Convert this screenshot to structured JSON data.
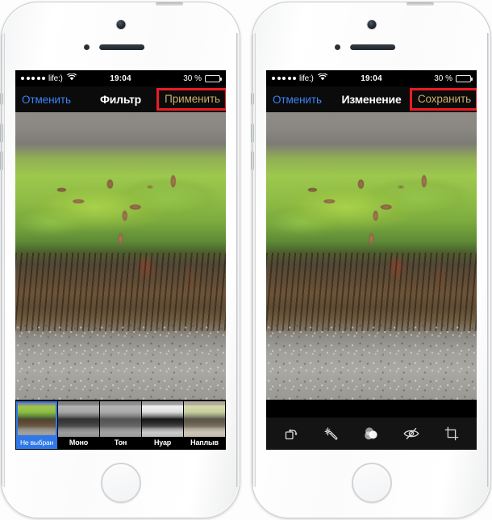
{
  "meta": {
    "description": "Two iPhone screenshots side by side showing the iOS Photos app filter screen and edit screen in Russian"
  },
  "colors": {
    "nav_action": "#c9ae6c",
    "nav_cancel": "#3b83f7",
    "highlight_box": "#ec1c24",
    "selected_blue": "#2f78e8",
    "screen_bg": "#000000"
  },
  "status_bar": {
    "signal_dots": 5,
    "carrier": "life:)",
    "wifi_icon": "wifi-icon",
    "time": "19:04",
    "battery_percent": "30 %",
    "battery_level": 30
  },
  "phones": [
    {
      "id": "left-phone",
      "nav": {
        "cancel_label": "Отменить",
        "title": "Фильтр",
        "action_label": "Применить",
        "action_highlighted": true
      },
      "photo": {
        "alt": "Green moss and pine cones on a rocky stump above gravel"
      },
      "filters": [
        {
          "label": "Не выбран",
          "selected": true,
          "style": "none"
        },
        {
          "label": "Моно",
          "selected": false,
          "style": "mono"
        },
        {
          "label": "Тон",
          "selected": false,
          "style": "tonal"
        },
        {
          "label": "Нуар",
          "selected": false,
          "style": "noir"
        },
        {
          "label": "Наплыв",
          "selected": false,
          "style": "fade"
        }
      ]
    },
    {
      "id": "right-phone",
      "nav": {
        "cancel_label": "Отменить",
        "title": "Изменение",
        "action_label": "Сохранить",
        "action_highlighted": true
      },
      "photo": {
        "alt": "Green moss and pine cones on a rocky stump above gravel"
      },
      "edit_tools": [
        {
          "name": "rotate-icon",
          "active": false
        },
        {
          "name": "magic-wand-icon",
          "active": false
        },
        {
          "name": "filters-icon",
          "active": true
        },
        {
          "name": "red-eye-icon",
          "active": false
        },
        {
          "name": "crop-icon",
          "active": false
        }
      ]
    }
  ],
  "hardware": {
    "camera": "front-camera",
    "sensor": "proximity-sensor",
    "speaker": "earpiece-speaker",
    "home_button": "home-button",
    "buttons": [
      "mute-switch",
      "volume-up-button",
      "volume-down-button",
      "power-button"
    ]
  }
}
